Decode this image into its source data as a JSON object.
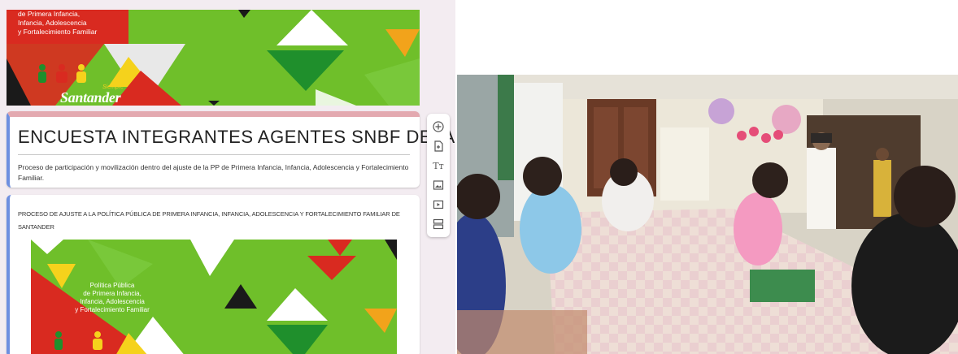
{
  "banner": {
    "text_lines": [
      "de Primera Infancia,",
      "Infancia, Adolescencia",
      "y Fortalecimiento Familiar"
    ],
    "logo_line1": "Siempre",
    "logo_line2": "Santander"
  },
  "form": {
    "title": "ENCUESTA INTEGRANTES AGENTES SNBF  DEPARTAMENTO",
    "description": "Proceso de participación y movilización dentro del ajuste de la PP de Primera Infancia, Infancia, Adolescencia y Fortalecimiento Familiar."
  },
  "question": {
    "text": "PROCESO DE AJUSTE A LA POLÍTICA PÚBLICA DE PRIMERA INFANCIA, INFANCIA, ADOLESCENCIA Y FORTALECIMIENTO FAMILIAR DE SANTANDER",
    "image_text_lines": [
      "Política Pública",
      "de Primera Infancia,",
      "Infancia, Adolescencia",
      "y Fortalecimiento Familiar"
    ]
  },
  "toolbar": {
    "items": [
      {
        "name": "add-question",
        "icon": "add-circle-icon"
      },
      {
        "name": "import-questions",
        "icon": "import-icon"
      },
      {
        "name": "add-title",
        "icon": "title-icon",
        "glyph": "Tт"
      },
      {
        "name": "add-image",
        "icon": "image-icon"
      },
      {
        "name": "add-video",
        "icon": "video-icon"
      },
      {
        "name": "add-section",
        "icon": "section-icon"
      }
    ]
  },
  "colors": {
    "banner_green": "#6fbf2a",
    "banner_red": "#d92a20",
    "accent_blue": "#6d8fe0",
    "header_pink": "#e3a9b0",
    "page_bg": "#f3ecf1"
  }
}
